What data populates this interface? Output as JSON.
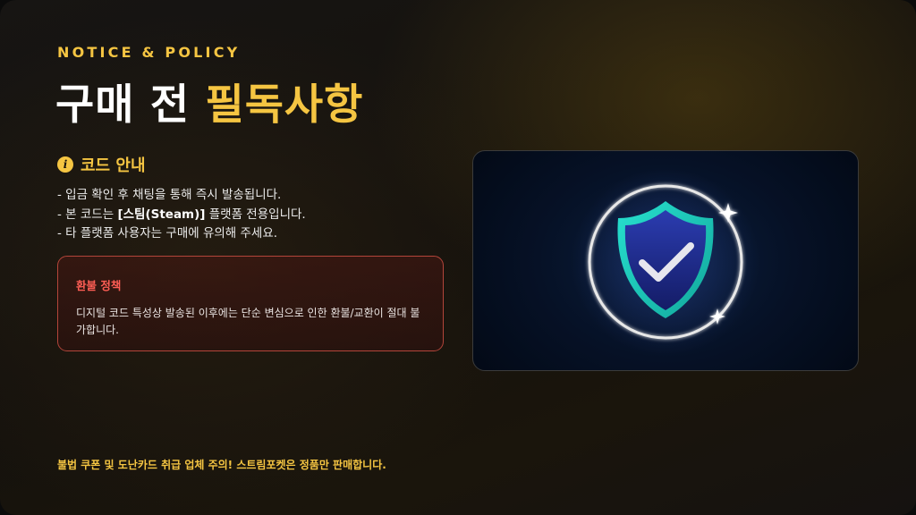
{
  "header": {
    "eyebrow": "NOTICE & POLICY",
    "title_main": "구매 전 ",
    "title_accent": "필독사항"
  },
  "code_guide": {
    "icon": "info-icon",
    "title": "코드 안내",
    "items": [
      {
        "text": "- 입금 확인 후 채팅을 통해 즉시 발송됩니다."
      },
      {
        "prefix": "- 본 코드는 ",
        "bold": "[스팀(Steam)]",
        "suffix": " 플랫폼 전용입니다."
      },
      {
        "text": "- 타 플랫폼 사용자는 구매에 유의해 주세요."
      }
    ]
  },
  "refund_policy": {
    "title": "환불 정책",
    "body": "디지털 코드 특성상 발송된 이후에는 단순 변심으로 인한 환불/교환이 절대 불가합니다."
  },
  "illustration": {
    "icon": "shield-check-icon",
    "colors": {
      "shield_fill": "#1e2a8a",
      "shield_edge": "#1fd6c4",
      "ring": "#e8e8e8",
      "check": "#e6e6ee"
    }
  },
  "footer": {
    "notice": "불법 쿠폰 및 도난카드 취급 업체 주의! 스트림포켓은 정품만 판매합니다."
  },
  "colors": {
    "accent": "#f5c542",
    "danger": "#ff5e55",
    "background": "#14110d"
  }
}
